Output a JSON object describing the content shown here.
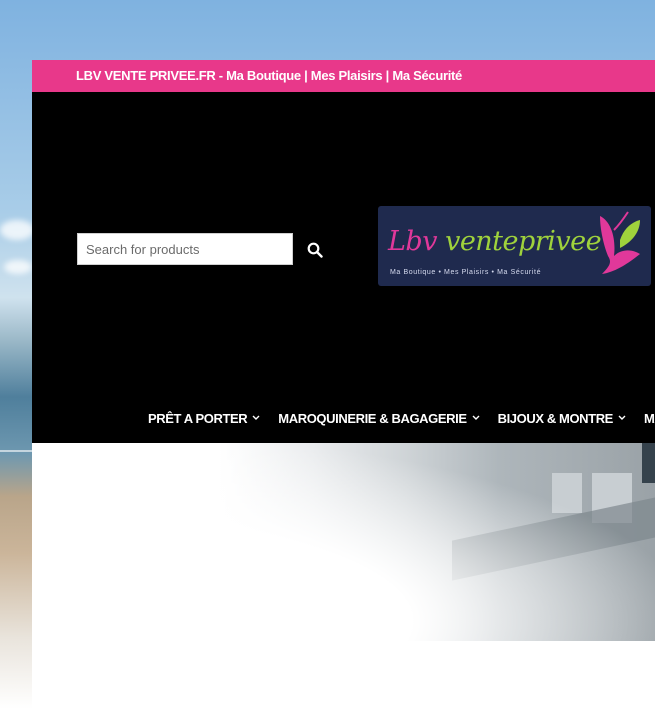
{
  "topbar": {
    "text": "LBV VENTE PRIVEE.FR - Ma Boutique | Mes Plaisirs | Ma Sécurité"
  },
  "search": {
    "placeholder": "Search for products",
    "button_icon": "search-icon"
  },
  "logo": {
    "word_part1": "Lbv",
    "word_part2": "venteprivee",
    "tagline": "Ma Boutique  •  Mes Plaisirs  •  Ma Sécurité"
  },
  "nav": {
    "items": [
      {
        "label": "PRÊT A PORTER",
        "icon": "chevron-down-icon"
      },
      {
        "label": "MAROQUINERIE & BAGAGERIE",
        "icon": "chevron-down-icon"
      },
      {
        "label": "BIJOUX & MONTRE",
        "icon": "chevron-down-icon"
      },
      {
        "label": "MA"
      }
    ]
  },
  "colors": {
    "topbar": "#e8388a",
    "header": "#000000",
    "logo_bg": "#1f2a4e",
    "logo_pink": "#e0389a",
    "logo_green": "#9fd23c"
  }
}
